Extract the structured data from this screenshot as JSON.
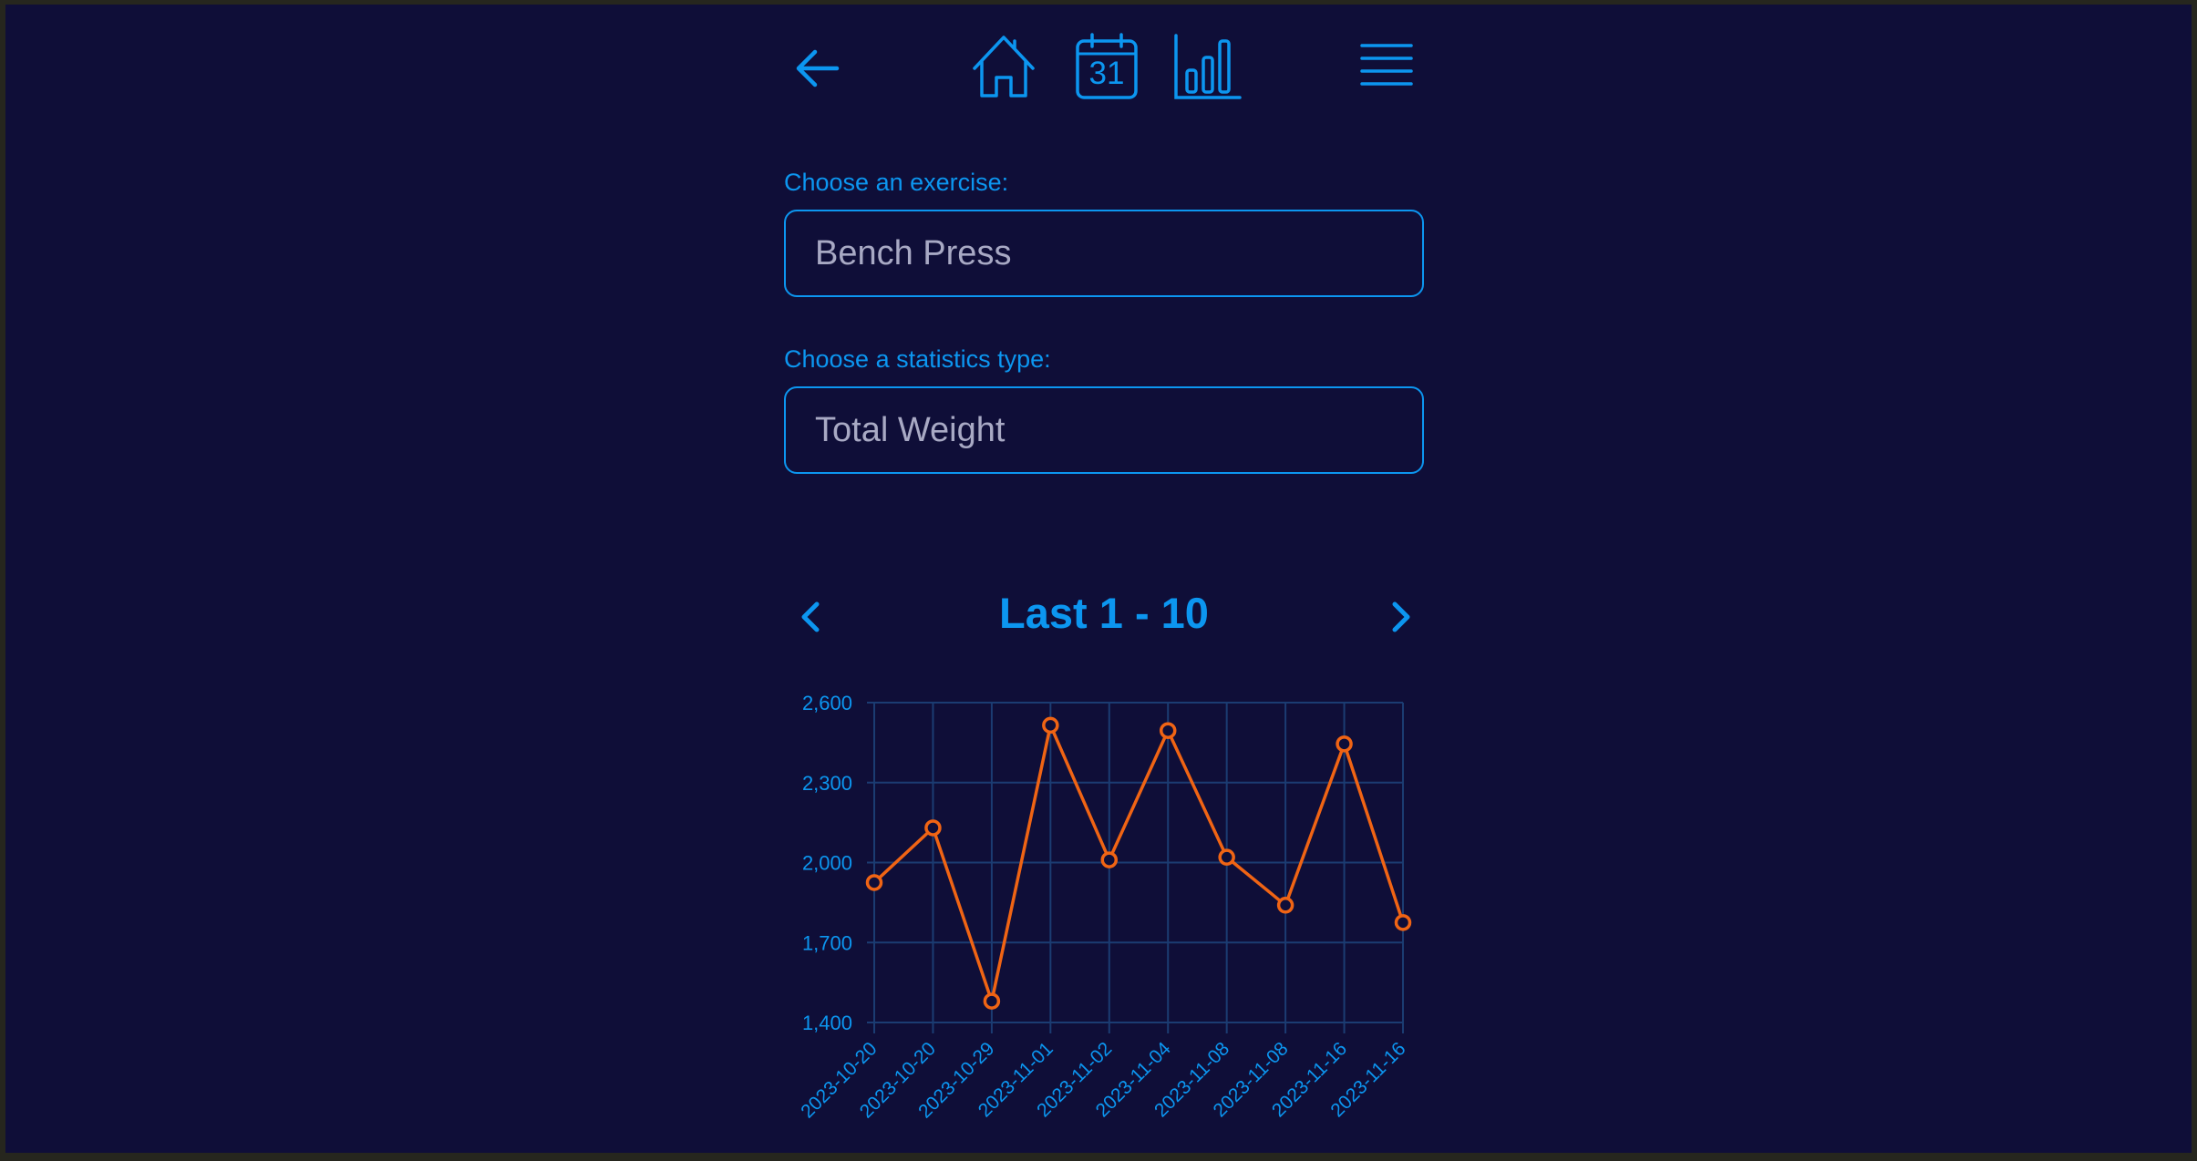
{
  "nav": {
    "back_icon": "arrow-left-icon",
    "home_icon": "home-icon",
    "calendar_icon": "calendar-icon",
    "calendar_day": "31",
    "stats_icon": "bar-chart-icon",
    "menu_icon": "hamburger-menu-icon"
  },
  "exercise": {
    "label": "Choose an exercise:",
    "value": "Bench Press"
  },
  "stat_type": {
    "label": "Choose a statistics type:",
    "value": "Total Weight"
  },
  "pager": {
    "title": "Last 1 - 10",
    "prev_icon": "chevron-left-icon",
    "next_icon": "chevron-right-icon"
  },
  "colors": {
    "background": "#0f0e38",
    "accent": "#0c96f0",
    "series": "#f06414",
    "grid": "#1b3c72"
  },
  "chart_data": {
    "type": "line",
    "x": [
      "2023-10-20",
      "2023-10-20",
      "2023-10-29",
      "2023-11-01",
      "2023-11-02",
      "2023-11-04",
      "2023-11-08",
      "2023-11-08",
      "2023-11-16",
      "2023-11-16"
    ],
    "values": [
      1925,
      2130,
      1480,
      2515,
      2010,
      2495,
      2020,
      1840,
      2445,
      1775
    ],
    "ylim": [
      1400,
      2600
    ],
    "yticks": [
      2600,
      2300,
      2000,
      1700,
      1400
    ],
    "ytick_labels": [
      "2,600",
      "2,300",
      "2,000",
      "1,700",
      "1,400"
    ],
    "grid": true,
    "legend": "none",
    "markers": "hollow-circle"
  }
}
